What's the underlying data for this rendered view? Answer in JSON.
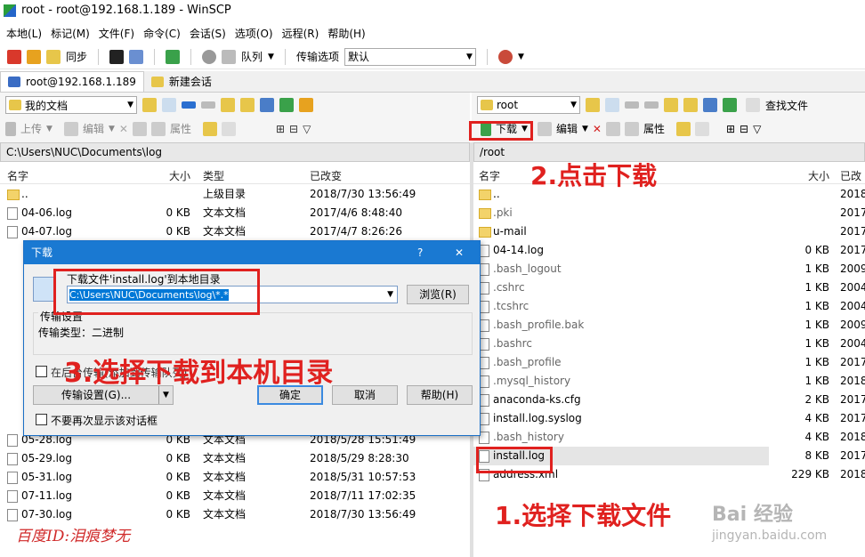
{
  "window": {
    "title": "root - root@192.168.1.189 - WinSCP"
  },
  "menu": [
    "本地(L)",
    "标记(M)",
    "文件(F)",
    "命令(C)",
    "会话(S)",
    "选项(O)",
    "远程(R)",
    "帮助(H)"
  ],
  "toolbar": {
    "sync": "同步",
    "queue": "队列",
    "transfer_options_label": "传输选项",
    "transfer_options_value": "默认"
  },
  "sessions": {
    "tab1": "root@192.168.1.189",
    "new_session": "新建会话"
  },
  "left": {
    "location": "我的文档",
    "actions": {
      "upload": "上传",
      "edit": "编辑",
      "properties": "属性"
    },
    "path": "C:\\Users\\NUC\\Documents\\log",
    "columns": {
      "name": "名字",
      "size": "大小",
      "type": "类型",
      "changed": "已改变"
    },
    "rows": [
      {
        "name": "..",
        "size": "",
        "type": "上级目录",
        "changed": "2018/7/30   13:56:49",
        "kind": "up"
      },
      {
        "name": "04-06.log",
        "size": "0 KB",
        "type": "文本文档",
        "changed": "2017/4/6   8:48:40",
        "kind": "file"
      },
      {
        "name": "04-07.log",
        "size": "0 KB",
        "type": "文本文档",
        "changed": "2017/4/7   8:26:26",
        "kind": "file"
      },
      {
        "name": "05-28.log",
        "size": "0 KB",
        "type": "文本文档",
        "changed": "2018/5/28   15:51:49",
        "kind": "file"
      },
      {
        "name": "05-29.log",
        "size": "0 KB",
        "type": "文本文档",
        "changed": "2018/5/29   8:28:30",
        "kind": "file"
      },
      {
        "name": "05-31.log",
        "size": "0 KB",
        "type": "文本文档",
        "changed": "2018/5/31   10:57:53",
        "kind": "file"
      },
      {
        "name": "07-11.log",
        "size": "0 KB",
        "type": "文本文档",
        "changed": "2018/7/11   17:02:35",
        "kind": "file"
      },
      {
        "name": "07-30.log",
        "size": "0 KB",
        "type": "文本文档",
        "changed": "2018/7/30   13:56:49",
        "kind": "file"
      }
    ]
  },
  "right": {
    "location": "root",
    "find_files": "查找文件",
    "actions": {
      "download": "下载",
      "edit": "编辑",
      "properties": "属性"
    },
    "path": "/root",
    "columns": {
      "name": "名字",
      "size": "大小",
      "changed": "已改"
    },
    "rows": [
      {
        "name": "..",
        "size": "",
        "changed": "2018",
        "kind": "up"
      },
      {
        "name": ".pki",
        "size": "",
        "changed": "2017",
        "kind": "dir"
      },
      {
        "name": "u-mail",
        "size": "",
        "changed": "2017",
        "kind": "dir"
      },
      {
        "name": "04-14.log",
        "size": "0 KB",
        "changed": "2017",
        "kind": "file"
      },
      {
        "name": ".bash_logout",
        "size": "1 KB",
        "changed": "2009",
        "kind": "file"
      },
      {
        "name": ".cshrc",
        "size": "1 KB",
        "changed": "2004",
        "kind": "file"
      },
      {
        "name": ".tcshrc",
        "size": "1 KB",
        "changed": "2004",
        "kind": "file"
      },
      {
        "name": ".bash_profile.bak",
        "size": "1 KB",
        "changed": "2009",
        "kind": "file"
      },
      {
        "name": ".bashrc",
        "size": "1 KB",
        "changed": "2004",
        "kind": "file"
      },
      {
        "name": ".bash_profile",
        "size": "1 KB",
        "changed": "2017",
        "kind": "file"
      },
      {
        "name": ".mysql_history",
        "size": "1 KB",
        "changed": "2018",
        "kind": "file"
      },
      {
        "name": "anaconda-ks.cfg",
        "size": "2 KB",
        "changed": "2017",
        "kind": "file"
      },
      {
        "name": "install.log.syslog",
        "size": "4 KB",
        "changed": "2017",
        "kind": "file"
      },
      {
        "name": ".bash_history",
        "size": "4 KB",
        "changed": "2018",
        "kind": "file"
      },
      {
        "name": "install.log",
        "size": "8 KB",
        "changed": "2017",
        "kind": "file"
      },
      {
        "name": "address.xml",
        "size": "229 KB",
        "changed": "2018",
        "kind": "file"
      }
    ]
  },
  "dialog": {
    "title": "下载",
    "help": "?",
    "close": "✕",
    "prompt": "下载文件'install.log'到本地目录",
    "target": "C:\\Users\\NUC\\Documents\\log\\*.*",
    "browse": "浏览(R)",
    "group": "传输设置",
    "transfer_type": "传输类型：二进制",
    "background_checkbox": "在后台传输(添加到传输队列)",
    "settings_button": "传输设置(G)...",
    "ok": "确定",
    "cancel": "取消",
    "help_button": "帮助(H)",
    "no_show": "不要再次显示该对话框"
  },
  "annotations": {
    "step1": "1.选择下载文件",
    "step2": "2.点击下载",
    "step3": "3.选择下载到本机目录",
    "watermark": "百度ID:泪痕梦无",
    "site_logo": "Bai 经验",
    "site_url": "jingyan.baidu.com"
  },
  "colors": {
    "accent": "#1a79d2",
    "annotation": "#e0211f",
    "selected_row": "#e5e5e5"
  }
}
